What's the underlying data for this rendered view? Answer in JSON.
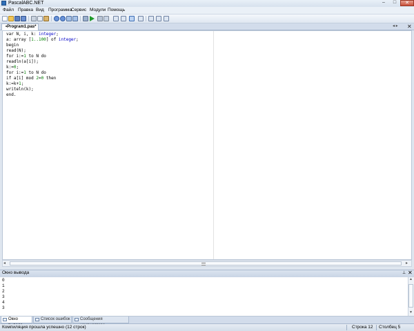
{
  "window": {
    "title": "PascalABC.NET",
    "minimize": "–",
    "maximize": "□",
    "close": "✕"
  },
  "menu": [
    "Файл",
    "Правка",
    "Вид",
    "Программа",
    "Сервис",
    "Модули",
    "Помощь"
  ],
  "toolbar": {
    "icons": [
      "new-file-icon",
      "open-file-icon",
      "save-icon",
      "save-all-icon",
      "cut-icon",
      "copy-icon",
      "paste-icon",
      "undo-icon",
      "redo-icon",
      "find-icon",
      "replace-icon",
      "compile-icon",
      "run-icon",
      "stop-icon",
      "step-over-icon",
      "step-into-icon",
      "step-out-icon",
      "watch-icon",
      "breakpoint-icon",
      "format-icon",
      "debug-window-icon",
      "options-icon"
    ]
  },
  "editor": {
    "tab_label": "•Program1.pas*",
    "tab_nav": "◂ ▸",
    "tab_close": "✕",
    "code_lines": [
      [
        {
          "t": "var N, i, k: ",
          "c": "kw"
        },
        {
          "t": "integer",
          "c": "ty"
        },
        {
          "t": ";",
          "c": "kw"
        }
      ],
      [
        {
          "t": "a: array [",
          "c": "kw"
        },
        {
          "t": "1..100",
          "c": "num"
        },
        {
          "t": "] of ",
          "c": "kw"
        },
        {
          "t": "integer",
          "c": "ty"
        },
        {
          "t": ";",
          "c": "kw"
        }
      ],
      [
        {
          "t": "begin",
          "c": "kw"
        }
      ],
      [
        {
          "t": "read(N);",
          "c": "kw"
        }
      ],
      [
        {
          "t": "for i:=",
          "c": "kw"
        },
        {
          "t": "1",
          "c": "num"
        },
        {
          "t": " to N do",
          "c": "kw"
        }
      ],
      [
        {
          "t": "readln(a[i]);",
          "c": "kw"
        }
      ],
      [
        {
          "t": "k:=",
          "c": "kw"
        },
        {
          "t": "0",
          "c": "num"
        },
        {
          "t": ";",
          "c": "kw"
        }
      ],
      [
        {
          "t": "for i:=",
          "c": "kw"
        },
        {
          "t": "1",
          "c": "num"
        },
        {
          "t": " to N do",
          "c": "kw"
        }
      ],
      [
        {
          "t": "if a[i] mod ",
          "c": "kw"
        },
        {
          "t": "2",
          "c": "num"
        },
        {
          "t": "=",
          "c": "kw"
        },
        {
          "t": "0",
          "c": "num"
        },
        {
          "t": " then",
          "c": "kw"
        }
      ],
      [
        {
          "t": "k:=k+",
          "c": "kw"
        },
        {
          "t": "1",
          "c": "num"
        },
        {
          "t": ";",
          "c": "kw"
        }
      ],
      [
        {
          "t": "writeln(k);",
          "c": "kw"
        }
      ],
      [
        {
          "t": "end.",
          "c": "kw"
        }
      ]
    ],
    "hscroll_left": "◂",
    "hscroll_right": "▸"
  },
  "output": {
    "title": "Окно вывода",
    "pin": "⊥",
    "close": "✕",
    "lines": [
      "0",
      "1",
      "2",
      "3",
      "4",
      "3"
    ],
    "scroll_up": "▲",
    "scroll_down": "▼"
  },
  "bottom_tabs": [
    {
      "label": "Окно вывода",
      "active": true
    },
    {
      "label": "Список ошибок",
      "active": false
    },
    {
      "label": "Сообщения компилятора",
      "active": false
    }
  ],
  "status": {
    "message": "Компиляция прошла успешно (12 строк)",
    "line_label": "Строка  12",
    "col_label": "Столбец  5"
  }
}
